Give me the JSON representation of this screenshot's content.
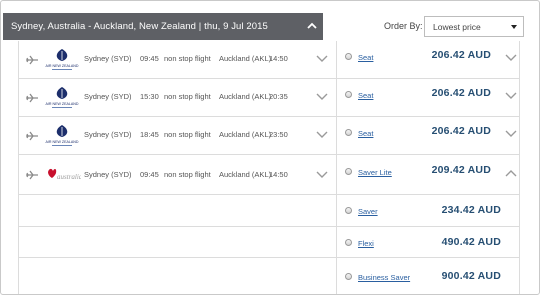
{
  "route": {
    "title": "Sydney, Australia - Auckland, New Zealand | thu, 9 Jul 2015"
  },
  "sort": {
    "label": "Order By:",
    "selected": "Lowest price"
  },
  "flights": [
    {
      "airline": "air-new-zealand",
      "logo_text": "AIR NEW ZEALAND",
      "origin": "Sydney (SYD)",
      "depart": "09:45",
      "stops": "non stop flight",
      "destination": "Auckland (AKL)",
      "arrive": "14:50",
      "fare_class": "Seat",
      "price": "206.42 AUD"
    },
    {
      "airline": "air-new-zealand",
      "logo_text": "AIR NEW ZEALAND",
      "origin": "Sydney (SYD)",
      "depart": "15:30",
      "stops": "non stop flight",
      "destination": "Auckland (AKL)",
      "arrive": "20:35",
      "fare_class": "Seat",
      "price": "206.42 AUD"
    },
    {
      "airline": "air-new-zealand",
      "logo_text": "AIR NEW ZEALAND",
      "origin": "Sydney (SYD)",
      "depart": "18:45",
      "stops": "non stop flight",
      "destination": "Auckland (AKL)",
      "arrive": "23:50",
      "fare_class": "Seat",
      "price": "206.42 AUD"
    },
    {
      "airline": "virgin-australia",
      "logo_text": "australia",
      "origin": "Sydney (SYD)",
      "depart": "09:45",
      "stops": "non stop flight",
      "destination": "Auckland (AKL)",
      "arrive": "14:50",
      "fare_class": "Saver Lite",
      "price": "209.42 AUD"
    }
  ],
  "extra_fares": [
    {
      "fare_class": "Saver",
      "price": "234.42 AUD"
    },
    {
      "fare_class": "Flexi",
      "price": "490.42 AUD"
    },
    {
      "fare_class": "Business Saver",
      "price": "900.42 AUD"
    }
  ],
  "colors": {
    "header_bg": "#5e6065",
    "price": "#274f73",
    "link": "#2a5fa0"
  }
}
